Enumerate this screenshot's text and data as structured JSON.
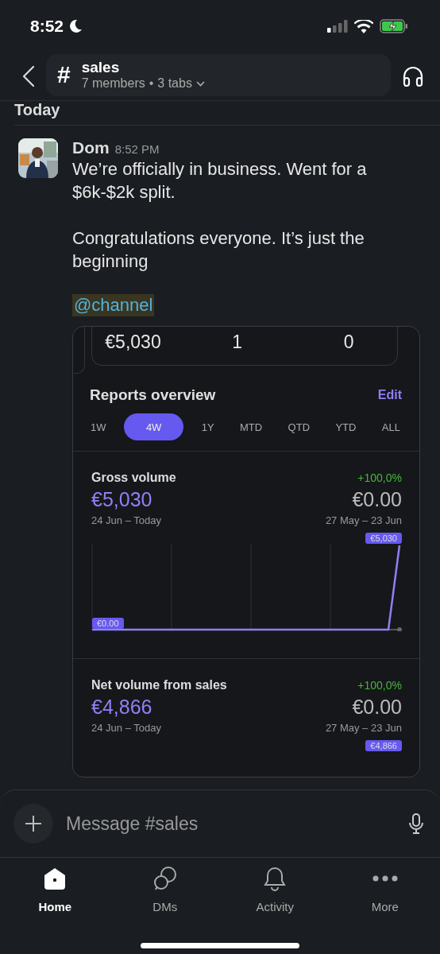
{
  "status_bar": {
    "time": "8:52"
  },
  "header": {
    "channel_symbol": "#",
    "channel": "sales",
    "members": "7 members",
    "separator": "•",
    "tabs": "3 tabs"
  },
  "date_divider": "Today",
  "message": {
    "author": "Dom",
    "time": "8:52 PM",
    "paragraphs": [
      "We’re officially in business. Went for a $6k-$2k split.",
      "Congratulations everyone. It’s just the beginning"
    ],
    "mention": "@channel",
    "attachment": {
      "stats": [
        "€5,030",
        "1",
        "0"
      ],
      "title": "Reports overview",
      "action": "Edit",
      "periods": [
        {
          "label": "1W",
          "selected": false
        },
        {
          "label": "4W",
          "selected": true
        },
        {
          "label": "1Y",
          "selected": false
        },
        {
          "label": "MTD",
          "selected": false
        },
        {
          "label": "QTD",
          "selected": false
        },
        {
          "label": "YTD",
          "selected": false
        },
        {
          "label": "ALL",
          "selected": false
        }
      ],
      "metrics": [
        {
          "name": "Gross volume",
          "change": "+100,0%",
          "value": "€5,030",
          "previous_value": "€0.00",
          "period": "24 Jun – Today",
          "previous_period": "27 May – 23 Jun",
          "start_label": "€0.00",
          "end_label": "€5,030"
        },
        {
          "name": "Net volume from sales",
          "change": "+100,0%",
          "value": "€4,866",
          "previous_value": "€0.00",
          "period": "24 Jun – Today",
          "previous_period": "27 May – 23 Jun",
          "end_label": "€4,866"
        }
      ]
    }
  },
  "composer": {
    "placeholder": "Message #sales"
  },
  "tab_bar": [
    {
      "label": "Home",
      "selected": true
    },
    {
      "label": "DMs",
      "selected": false
    },
    {
      "label": "Activity",
      "selected": false
    },
    {
      "label": "More",
      "selected": false
    }
  ]
}
